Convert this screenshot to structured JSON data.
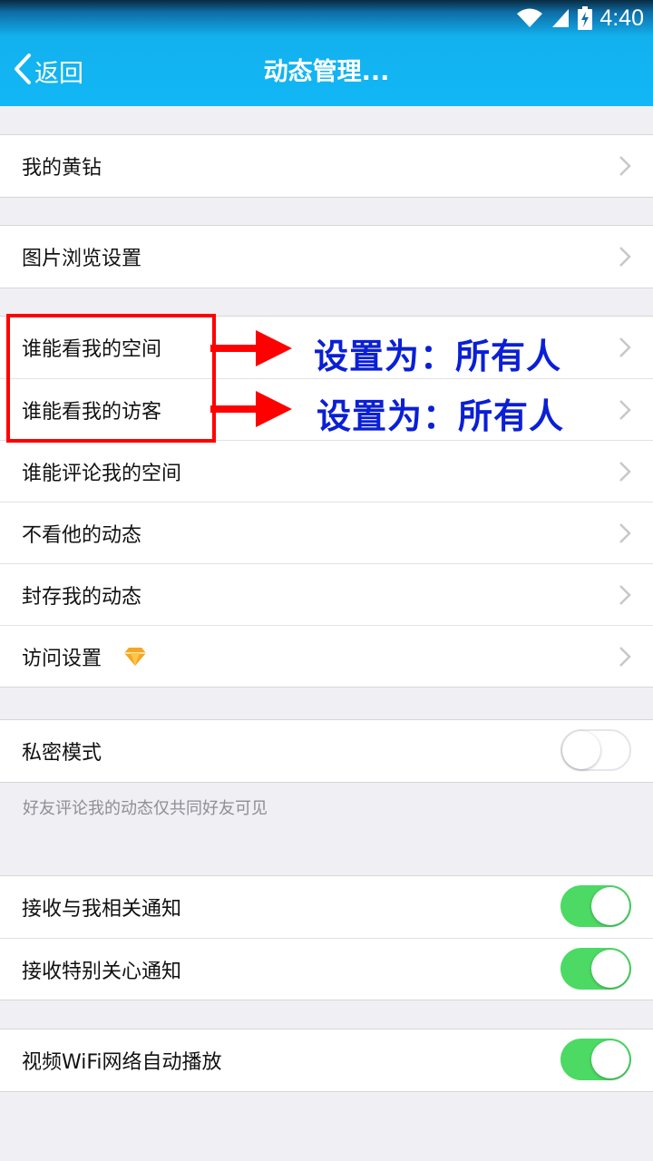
{
  "status_bar": {
    "time": "4:40"
  },
  "header": {
    "back_label": "返回",
    "title": "动态管理..."
  },
  "groups": {
    "g1": [
      "我的黄钻"
    ],
    "g2": [
      "图片浏览设置"
    ],
    "g3": [
      "谁能看我的空间",
      "谁能看我的访客",
      "谁能评论我的空间",
      "不看他的动态",
      "封存我的动态",
      "访问设置"
    ],
    "g4": {
      "label": "私密模式",
      "on": false,
      "note": "好友评论我的动态仅共同好友可见"
    },
    "g5": [
      {
        "label": "接收与我相关通知",
        "on": true
      },
      {
        "label": "接收特别关心通知",
        "on": true
      }
    ],
    "g6": [
      {
        "label": "视频WiFi网络自动播放",
        "on": true
      }
    ]
  },
  "annotations": {
    "line1": "设置为：所有人",
    "line2": "设置为：所有人"
  },
  "colors": {
    "header": "#12b7f5",
    "toggle_on": "#4cd964",
    "annotation_red": "#ff0000",
    "annotation_blue": "#0a1fd6",
    "diamond": "#f5a623"
  }
}
